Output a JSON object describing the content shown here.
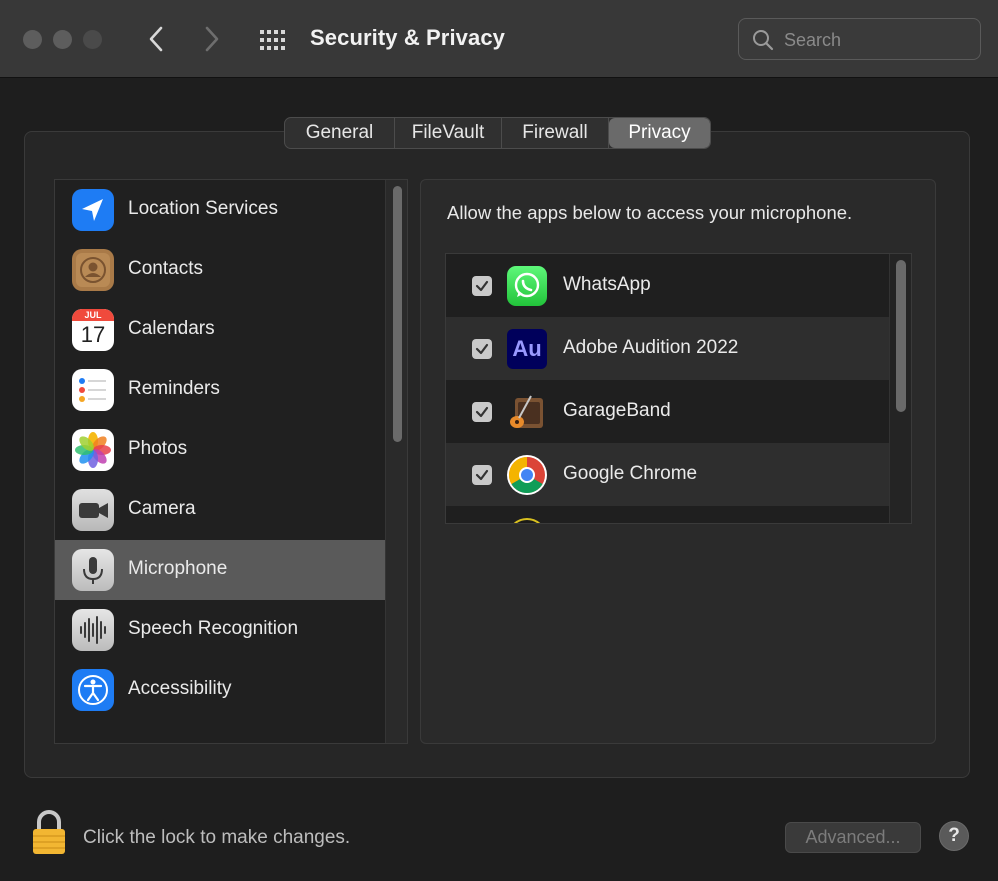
{
  "window": {
    "title": "Security & Privacy",
    "search_placeholder": "Search"
  },
  "tabs": [
    {
      "label": "General",
      "selected": false
    },
    {
      "label": "FileVault",
      "selected": false
    },
    {
      "label": "Firewall",
      "selected": false
    },
    {
      "label": "Privacy",
      "selected": true
    }
  ],
  "sidebar": {
    "items": [
      {
        "label": "Location Services",
        "icon": "location-arrow-icon"
      },
      {
        "label": "Contacts",
        "icon": "contacts-icon"
      },
      {
        "label": "Calendars",
        "icon": "calendar-icon",
        "month": "JUL",
        "day": "17"
      },
      {
        "label": "Reminders",
        "icon": "reminders-icon"
      },
      {
        "label": "Photos",
        "icon": "photos-icon"
      },
      {
        "label": "Camera",
        "icon": "camera-icon"
      },
      {
        "label": "Microphone",
        "icon": "microphone-icon",
        "selected": true
      },
      {
        "label": "Speech Recognition",
        "icon": "speech-waveform-icon"
      },
      {
        "label": "Accessibility",
        "icon": "accessibility-icon"
      }
    ]
  },
  "detail": {
    "header": "Allow the apps below to access your microphone.",
    "apps": [
      {
        "name": "WhatsApp",
        "checked": true,
        "icon": "whatsapp-icon"
      },
      {
        "name": "Adobe Audition 2022",
        "checked": true,
        "icon": "adobe-audition-icon",
        "icon_text": "Au"
      },
      {
        "name": "GarageBand",
        "checked": true,
        "icon": "garageband-icon"
      },
      {
        "name": "Google Chrome",
        "checked": true,
        "icon": "chrome-icon"
      }
    ]
  },
  "footer": {
    "lock_text": "Click the lock to make changes.",
    "advanced_label": "Advanced...",
    "help_label": "?"
  },
  "colors": {
    "window_bg": "#1e1e1e",
    "titlebar_bg": "#383838",
    "selected_row": "#5a5a5a",
    "selected_tab": "#6a6a6a"
  }
}
